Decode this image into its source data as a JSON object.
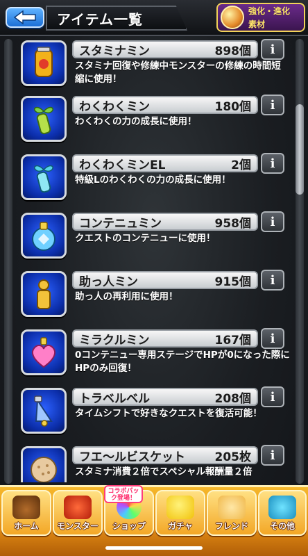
{
  "header": {
    "title": "アイテム一覧",
    "badge_line1": "強化・進化",
    "badge_line2": "素材"
  },
  "items": [
    {
      "name": "スタミナミン",
      "count": "898個",
      "desc": "スタミナ回復や修練中モンスターの修練の時間短縮に使用！",
      "icon": "stamina-can-icon",
      "icon_color": "#f2b21a"
    },
    {
      "name": "わくわくミン",
      "count": "180個",
      "desc": "わくわくの力の成長に使用！",
      "icon": "sprout-bottle-icon",
      "icon_color": "#b6e04a"
    },
    {
      "name": "わくわくミンEL",
      "count": "2個",
      "desc": "特級Lのわくわくの力の成長に使用！",
      "icon": "sprout-bottle-el-icon",
      "icon_color": "#56d3e8"
    },
    {
      "name": "コンテニュミン",
      "count": "958個",
      "desc": "クエストのコンテニューに使用！",
      "icon": "continue-potion-icon",
      "icon_color": "#6fd0ff"
    },
    {
      "name": "助っ人ミン",
      "count": "915個",
      "desc": "助っ人の再利用に使用！",
      "icon": "helper-bottle-icon",
      "icon_color": "#f3c23a"
    },
    {
      "name": "ミラクルミン",
      "count": "167個",
      "desc": "0コンテニュー専用ステージでHPが0になった際にHPのみ回復！",
      "icon": "miracle-heart-icon",
      "icon_color": "#ff7fc8"
    },
    {
      "name": "トラベルベル",
      "count": "208個",
      "desc": "タイムシフトで好きなクエストを復活可能！",
      "icon": "travel-bell-icon",
      "icon_color": "#9fc7ff"
    },
    {
      "name": "フエ～ルビスケット",
      "count": "205枚",
      "desc": "スタミナ消費２倍でスペシャル報酬量２倍",
      "icon": "biscuit-icon",
      "icon_color": "#e8caa0"
    }
  ],
  "nav": {
    "collab_tag": "コラボパック登場！",
    "home": "ホーム",
    "monster": "モンスター",
    "shop": "ショップ",
    "gacha": "ガチャ",
    "friend": "フレンド",
    "other": "その他"
  }
}
